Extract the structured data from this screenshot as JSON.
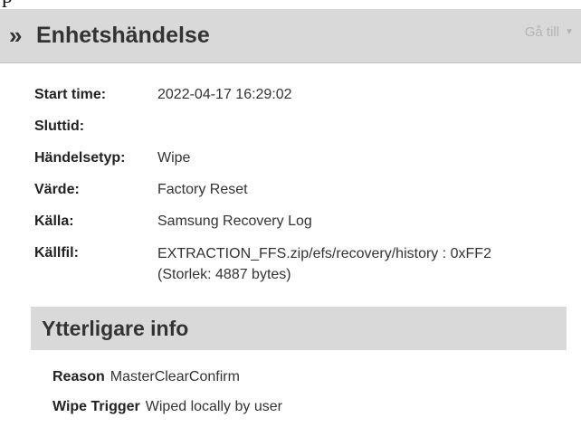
{
  "header": {
    "title": "Enhetshändelse",
    "goto_label": "Gå till",
    "chevron_icon": "double-chevron-right-icon"
  },
  "details": {
    "start_time": {
      "label": "Start time:",
      "value": "2022-04-17 16:29:02"
    },
    "end_time": {
      "label": "Sluttid:",
      "value": ""
    },
    "event_type": {
      "label": "Händelsetyp:",
      "value": "Wipe"
    },
    "value": {
      "label": "Värde:",
      "value": "Factory Reset"
    },
    "source": {
      "label": "Källa:",
      "value": "Samsung Recovery Log"
    },
    "source_file": {
      "label": "Källfil:",
      "value_line1": "EXTRACTION_FFS.zip/efs/recovery/history : 0xFF2",
      "value_line2": "(Storlek: 4887 bytes)"
    }
  },
  "additional": {
    "title": "Ytterligare info",
    "reason": {
      "label": "Reason",
      "value": "MasterClearConfirm"
    },
    "wipe_trigger": {
      "label": "Wipe Trigger",
      "value": "Wiped locally by user"
    }
  }
}
